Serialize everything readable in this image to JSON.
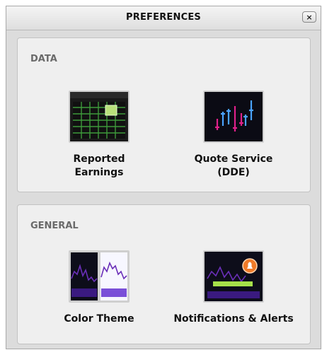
{
  "window": {
    "title": "PREFERENCES",
    "close_label": "×"
  },
  "sections": {
    "data": {
      "label": "DATA",
      "tiles": [
        {
          "label": "Reported\nEarnings",
          "icon": "earnings-grid-icon"
        },
        {
          "label": "Quote Service\n(DDE)",
          "icon": "quote-service-icon"
        }
      ]
    },
    "general": {
      "label": "GENERAL",
      "tiles": [
        {
          "label": "Color Theme",
          "icon": "color-theme-icon"
        },
        {
          "label": "Notifications & Alerts",
          "icon": "notification-alert-icon"
        }
      ]
    }
  },
  "colors": {
    "grid_green": "#3e9a3a",
    "highlight_green": "#b8e07a",
    "chart_purple": "#6a2fb8",
    "quote_blue": "#4aa3ff",
    "quote_magenta": "#e0218a",
    "alert_orange": "#f07a28",
    "alert_bar_green": "#a6e04a"
  }
}
